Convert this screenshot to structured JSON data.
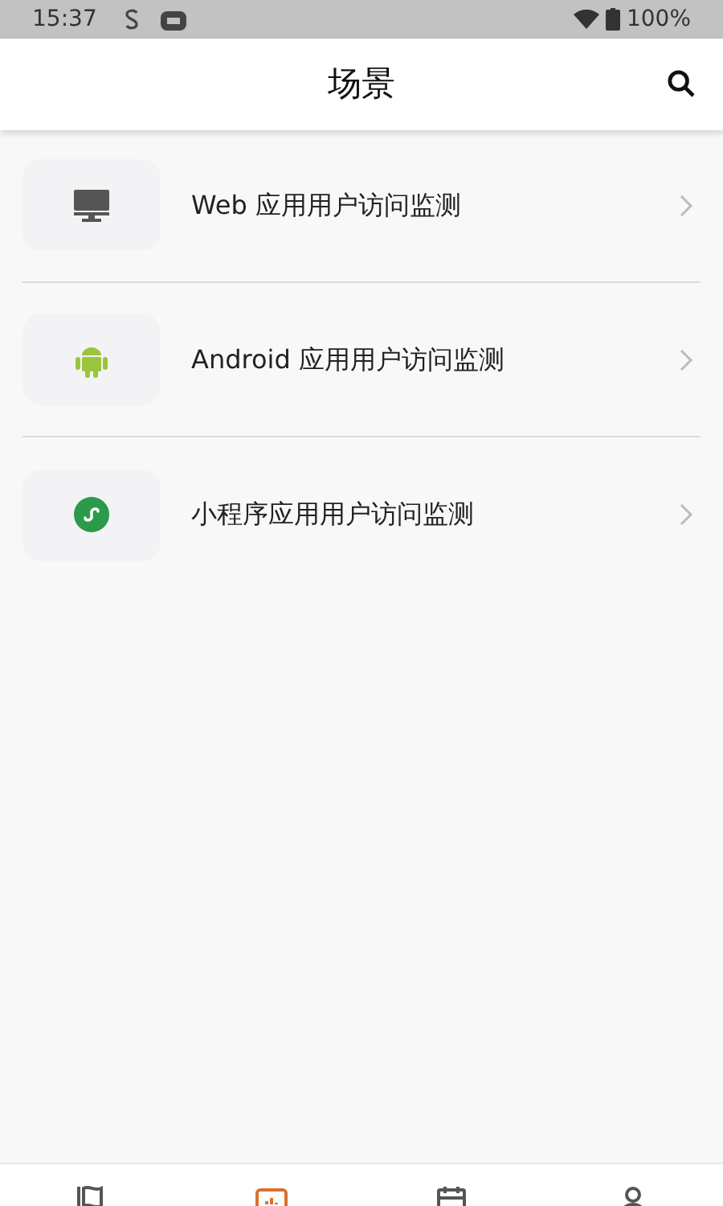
{
  "status_bar": {
    "time": "15:37",
    "battery": "100%"
  },
  "header": {
    "title": "场景"
  },
  "scenes": [
    {
      "kind": "web",
      "label": "Web 应用用户访问监测"
    },
    {
      "kind": "android",
      "label": "Android 应用用户访问监测"
    },
    {
      "kind": "miniprogram",
      "label": "小程序应用用户访问监测"
    }
  ],
  "tab_bar": [
    {
      "kind": "flag",
      "selected": false
    },
    {
      "kind": "dashboard",
      "selected": true
    },
    {
      "kind": "calendar",
      "selected": false
    },
    {
      "kind": "person",
      "selected": false
    }
  ]
}
